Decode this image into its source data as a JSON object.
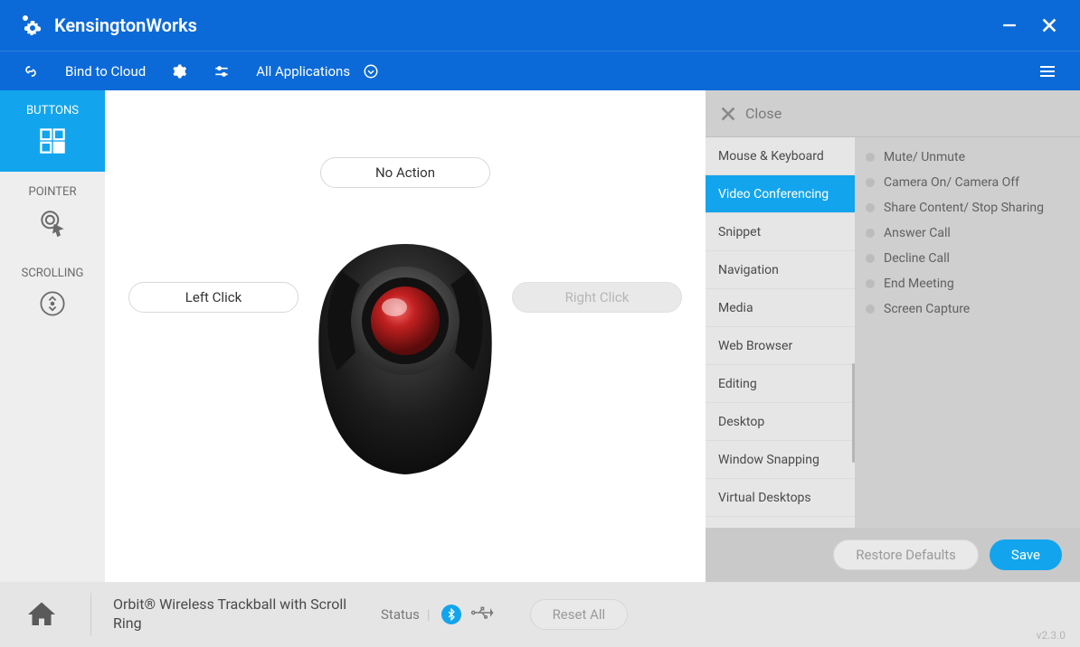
{
  "app": {
    "title": "KensingtonWorks"
  },
  "toolbar": {
    "bind_label": "Bind to Cloud",
    "app_scope": "All Applications"
  },
  "sidenav": {
    "buttons": "BUTTONS",
    "pointer": "POINTER",
    "scrolling": "SCROLLING"
  },
  "pills": {
    "top": "No Action",
    "left": "Left Click",
    "right": "Right Click"
  },
  "panel": {
    "close": "Close",
    "categories": [
      "Mouse & Keyboard",
      "Video Conferencing",
      "Snippet",
      "Navigation",
      "Media",
      "Web Browser",
      "Editing",
      "Desktop",
      "Window Snapping",
      "Virtual Desktops"
    ],
    "active_category_index": 1,
    "actions": [
      "Mute/ Unmute",
      "Camera On/ Camera Off",
      "Share Content/ Stop Sharing",
      "Answer Call",
      "Decline Call",
      "End Meeting",
      "Screen Capture"
    ],
    "restore": "Restore Defaults",
    "save": "Save"
  },
  "footer": {
    "device": "Orbit® Wireless Trackball with Scroll Ring",
    "status": "Status",
    "reset": "Reset All",
    "version": "v2.3.0"
  }
}
